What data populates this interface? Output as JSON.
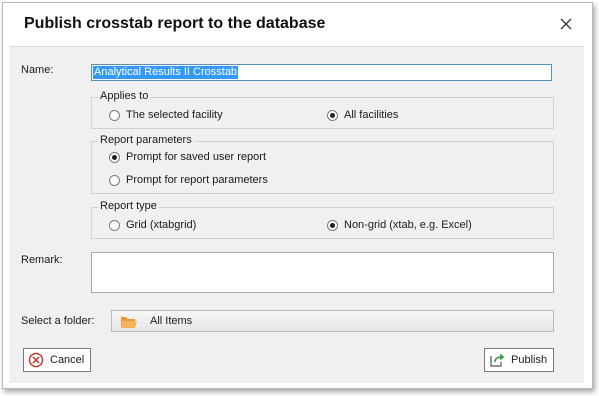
{
  "dialog": {
    "title": "Publish crosstab report to the database",
    "close_icon": "close-icon"
  },
  "form": {
    "name_label": "Name:",
    "name_value": "Analytical Results II Crosstab",
    "applies_to": {
      "legend": "Applies to",
      "options": [
        "The selected facility",
        "All facilities"
      ],
      "selected": "All facilities"
    },
    "report_parameters": {
      "legend": "Report parameters",
      "options": [
        "Prompt for saved user report",
        "Prompt for report parameters"
      ],
      "selected": "Prompt for saved user report"
    },
    "report_type": {
      "legend": "Report type",
      "options": [
        "Grid (xtabgrid)",
        "Non-grid (xtab, e.g. Excel)"
      ],
      "selected": "Non-grid (xtab, e.g. Excel)"
    },
    "remark_label": "Remark:",
    "remark_value": "",
    "folder_label": "Select a folder:",
    "folder_value": "All Items",
    "folder_icon": "folder-icon"
  },
  "buttons": {
    "cancel": "Cancel",
    "cancel_icon": "cancel-circle-icon",
    "publish": "Publish",
    "publish_icon": "export-arrow-icon"
  },
  "colors": {
    "selection": "#3399ff",
    "cancel_red": "#c0392b",
    "publish_green": "#2e9e3e",
    "folder_orange": "#f0a040"
  }
}
